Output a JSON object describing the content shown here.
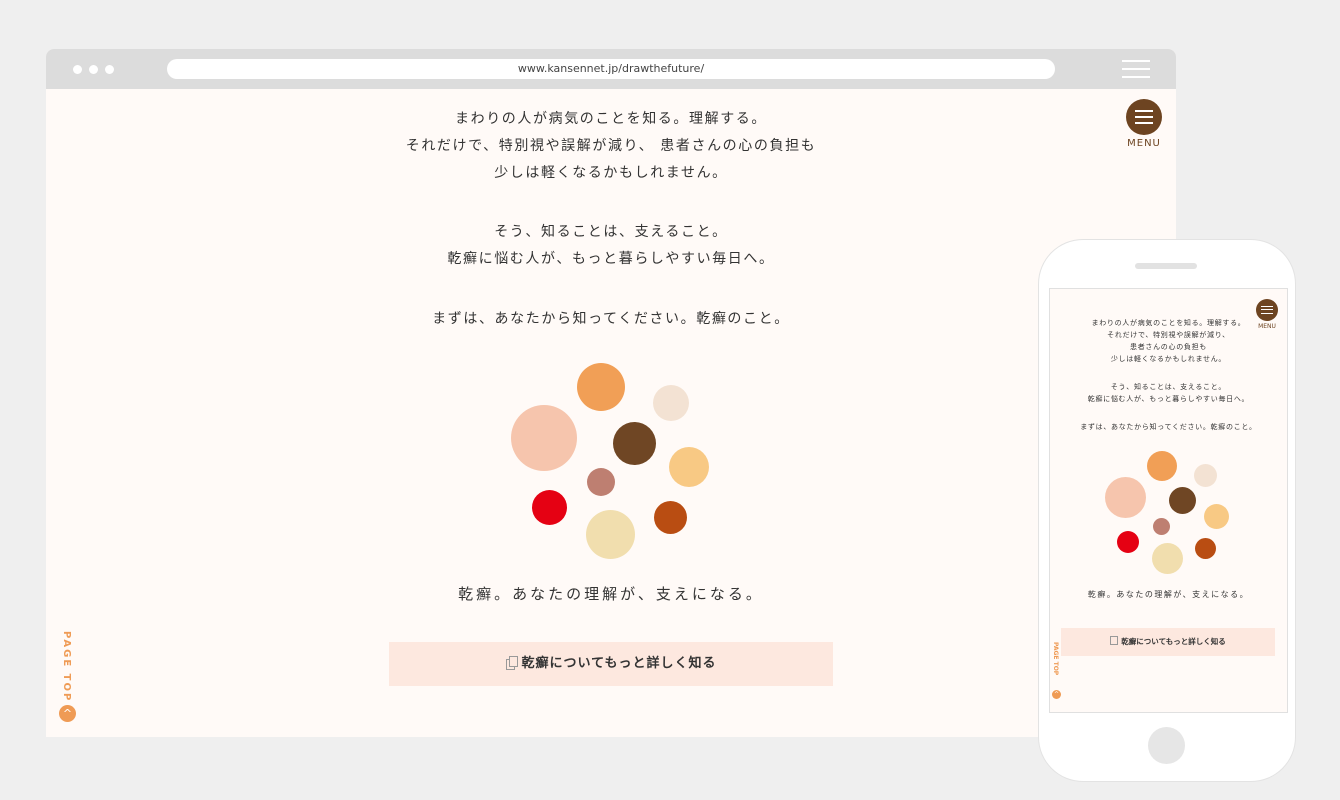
{
  "browser": {
    "url": "www.kansennet.jp/drawthefuture/"
  },
  "menu": {
    "label": "MENU"
  },
  "copy": {
    "paragraph1": [
      "まわりの人が病気のことを知る。理解する。",
      "それだけで、特別視や誤解が減り、 患者さんの心の負担も",
      "少しは軽くなるかもしれません。"
    ],
    "paragraph2": [
      "そう、知ることは、支えること。",
      "乾癬に悩む人が、もっと暮らしやすい毎日へ。"
    ],
    "paragraph3": "まずは、あなたから知ってください。乾癬のこと。"
  },
  "mobile_copy": {
    "paragraph1": [
      "まわりの人が病気のことを知る。理解する。",
      "それだけで、特別視や誤解が減り、",
      "患者さんの心の負担も",
      "少しは軽くなるかもしれません。"
    ]
  },
  "tagline": "乾癬。あなたの理解が、支えになる。",
  "cta": {
    "label": "乾癬についてもっと詳しく知る",
    "icon": "document-icon"
  },
  "page_top": {
    "label": "PAGE TOP",
    "icon": "chevron-up-icon"
  },
  "circle_colors": [
    "#f19f56",
    "#f3e2d3",
    "#f6c5ad",
    "#6f4624",
    "#f8c984",
    "#be7f71",
    "#e50113",
    "#f1deae",
    "#b94d12"
  ]
}
